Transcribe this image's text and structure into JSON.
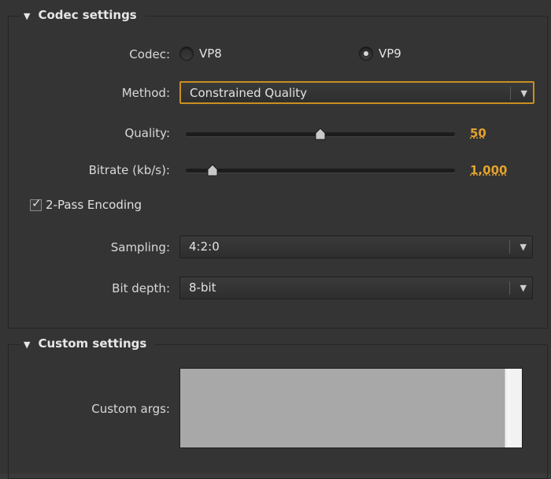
{
  "codec_settings": {
    "title": "Codec settings",
    "codec_label": "Codec:",
    "codec_options": [
      "VP8",
      "VP9"
    ],
    "codec_selected": "VP9",
    "method_label": "Method:",
    "method_value": "Constrained Quality",
    "quality_label": "Quality:",
    "quality_value": "50",
    "quality_fraction": 0.5,
    "bitrate_label": "Bitrate (kb/s):",
    "bitrate_value": "1,000",
    "bitrate_fraction": 0.1,
    "two_pass_label": "2-Pass Encoding",
    "two_pass_checked": true,
    "sampling_label": "Sampling:",
    "sampling_value": "4:2:0",
    "bit_depth_label": "Bit depth:",
    "bit_depth_value": "8-bit"
  },
  "custom_settings": {
    "title": "Custom settings",
    "custom_args_label": "Custom args:",
    "custom_args_value": ""
  },
  "icons": {
    "collapse": "triangle-down-icon",
    "dropdown": "chevron-down-icon"
  },
  "colors": {
    "accent": "#e4a22d",
    "focus_border": "#c98f21",
    "panel_bg": "#343434"
  }
}
